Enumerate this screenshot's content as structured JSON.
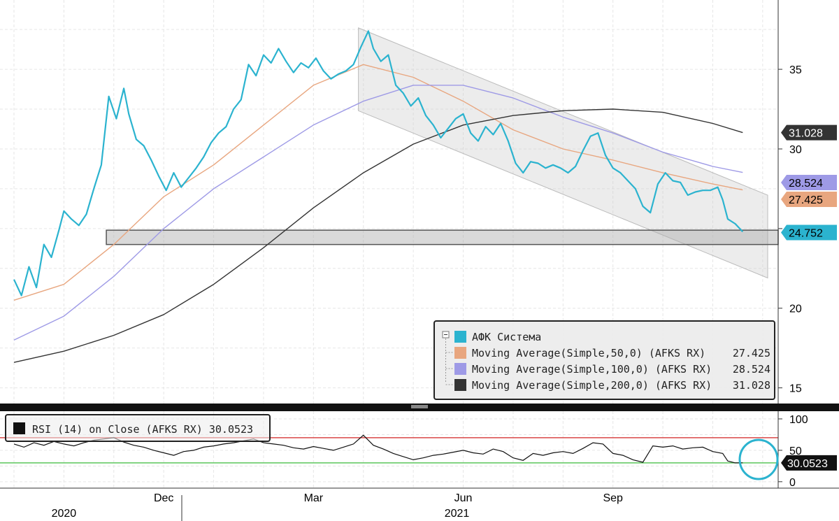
{
  "chart_data": [
    {
      "type": "line",
      "title": "",
      "ylim": [
        14.5,
        39
      ],
      "y_ticks": [
        15,
        20,
        25,
        30,
        35
      ],
      "y_tick_labels": [
        "15",
        "20",
        "",
        "30",
        "35"
      ],
      "x_ticks": [
        {
          "x": 3,
          "label": "Dec"
        },
        {
          "x": 6,
          "label": "Mar"
        },
        {
          "x": 9,
          "label": "Jun"
        },
        {
          "x": 12,
          "label": "Sep"
        }
      ],
      "years": [
        {
          "x": 1,
          "label": "2020"
        },
        {
          "x": 9,
          "label": "2021"
        }
      ],
      "xlim": [
        0,
        15.1
      ],
      "grid": true,
      "legend_position": "bottom-right",
      "series": [
        {
          "name": "АФК Система",
          "color": "#2bb3cf",
          "last_value": "24.752",
          "points": [
            [
              0,
              21.8
            ],
            [
              0.15,
              20.8
            ],
            [
              0.3,
              22.6
            ],
            [
              0.45,
              21.3
            ],
            [
              0.6,
              24.0
            ],
            [
              0.75,
              23.2
            ],
            [
              0.9,
              24.9
            ],
            [
              1.0,
              26.1
            ],
            [
              1.15,
              25.6
            ],
            [
              1.3,
              25.2
            ],
            [
              1.45,
              25.9
            ],
            [
              1.6,
              27.5
            ],
            [
              1.75,
              29.0
            ],
            [
              1.9,
              33.3
            ],
            [
              2.05,
              31.9
            ],
            [
              2.2,
              33.8
            ],
            [
              2.3,
              32.2
            ],
            [
              2.45,
              30.6
            ],
            [
              2.6,
              30.2
            ],
            [
              2.75,
              29.3
            ],
            [
              2.9,
              28.3
            ],
            [
              3.05,
              27.4
            ],
            [
              3.2,
              28.5
            ],
            [
              3.35,
              27.6
            ],
            [
              3.5,
              28.2
            ],
            [
              3.65,
              28.8
            ],
            [
              3.8,
              29.5
            ],
            [
              3.95,
              30.4
            ],
            [
              4.1,
              31.0
            ],
            [
              4.25,
              31.4
            ],
            [
              4.4,
              32.5
            ],
            [
              4.55,
              33.1
            ],
            [
              4.7,
              35.3
            ],
            [
              4.85,
              34.6
            ],
            [
              5.0,
              35.9
            ],
            [
              5.15,
              35.4
            ],
            [
              5.3,
              36.3
            ],
            [
              5.45,
              35.5
            ],
            [
              5.6,
              34.8
            ],
            [
              5.75,
              35.4
            ],
            [
              5.9,
              35.1
            ],
            [
              6.05,
              35.7
            ],
            [
              6.2,
              34.9
            ],
            [
              6.35,
              34.4
            ],
            [
              6.5,
              34.7
            ],
            [
              6.65,
              34.9
            ],
            [
              6.8,
              35.3
            ],
            [
              6.95,
              36.4
            ],
            [
              7.1,
              37.4
            ],
            [
              7.2,
              36.3
            ],
            [
              7.35,
              35.5
            ],
            [
              7.5,
              35.9
            ],
            [
              7.65,
              34.0
            ],
            [
              7.8,
              33.5
            ],
            [
              7.95,
              32.7
            ],
            [
              8.1,
              33.2
            ],
            [
              8.25,
              32.1
            ],
            [
              8.4,
              31.5
            ],
            [
              8.55,
              30.7
            ],
            [
              8.7,
              31.3
            ],
            [
              8.85,
              31.9
            ],
            [
              9.0,
              32.2
            ],
            [
              9.15,
              31.0
            ],
            [
              9.3,
              30.5
            ],
            [
              9.45,
              31.4
            ],
            [
              9.6,
              30.9
            ],
            [
              9.75,
              31.6
            ],
            [
              9.9,
              30.5
            ],
            [
              10.05,
              29.1
            ],
            [
              10.2,
              28.5
            ],
            [
              10.35,
              29.2
            ],
            [
              10.5,
              29.1
            ],
            [
              10.65,
              28.8
            ],
            [
              10.8,
              29.0
            ],
            [
              10.95,
              28.8
            ],
            [
              11.1,
              28.5
            ],
            [
              11.25,
              28.9
            ],
            [
              11.4,
              29.9
            ],
            [
              11.55,
              30.8
            ],
            [
              11.7,
              31.0
            ],
            [
              11.85,
              29.6
            ],
            [
              12.0,
              28.8
            ],
            [
              12.15,
              28.5
            ],
            [
              12.3,
              28.0
            ],
            [
              12.45,
              27.5
            ],
            [
              12.6,
              26.4
            ],
            [
              12.75,
              26.0
            ],
            [
              12.9,
              27.8
            ],
            [
              13.05,
              28.5
            ],
            [
              13.2,
              28.0
            ],
            [
              13.35,
              27.9
            ],
            [
              13.5,
              27.1
            ],
            [
              13.65,
              27.3
            ],
            [
              13.8,
              27.4
            ],
            [
              13.95,
              27.4
            ],
            [
              14.1,
              27.6
            ],
            [
              14.2,
              26.8
            ],
            [
              14.3,
              25.6
            ],
            [
              14.45,
              25.3
            ],
            [
              14.6,
              24.8
            ]
          ]
        },
        {
          "name": "Moving Average(Simple,50,0) (AFKS RX)",
          "color": "#e8a67f",
          "last_value": "27.425",
          "points": [
            [
              0,
              20.5
            ],
            [
              1,
              21.5
            ],
            [
              2,
              24.0
            ],
            [
              3,
              27.0
            ],
            [
              4,
              29.0
            ],
            [
              5,
              31.5
            ],
            [
              6,
              34.0
            ],
            [
              7,
              35.3
            ],
            [
              8,
              34.5
            ],
            [
              9,
              33.0
            ],
            [
              10,
              31.2
            ],
            [
              11,
              30.0
            ],
            [
              12,
              29.3
            ],
            [
              13,
              28.5
            ],
            [
              14,
              27.8
            ],
            [
              14.6,
              27.425
            ]
          ]
        },
        {
          "name": "Moving Average(Simple,100,0) (AFKS RX)",
          "color": "#9e9ae6",
          "last_value": "28.524",
          "points": [
            [
              0,
              18.0
            ],
            [
              1,
              19.5
            ],
            [
              2,
              22.0
            ],
            [
              3,
              25.0
            ],
            [
              4,
              27.5
            ],
            [
              5,
              29.5
            ],
            [
              6,
              31.5
            ],
            [
              7,
              33.0
            ],
            [
              8,
              34.0
            ],
            [
              9,
              34.0
            ],
            [
              10,
              33.2
            ],
            [
              11,
              32.0
            ],
            [
              12,
              31.0
            ],
            [
              13,
              29.8
            ],
            [
              14,
              28.9
            ],
            [
              14.6,
              28.524
            ]
          ]
        },
        {
          "name": "Moving Average(Simple,200,0) (AFKS RX)",
          "color": "#333333",
          "last_value": "31.028",
          "points": [
            [
              0,
              16.6
            ],
            [
              1,
              17.3
            ],
            [
              2,
              18.3
            ],
            [
              3,
              19.6
            ],
            [
              4,
              21.5
            ],
            [
              5,
              23.8
            ],
            [
              6,
              26.3
            ],
            [
              7,
              28.5
            ],
            [
              8,
              30.3
            ],
            [
              9,
              31.5
            ],
            [
              10,
              32.1
            ],
            [
              11,
              32.4
            ],
            [
              12,
              32.5
            ],
            [
              13,
              32.3
            ],
            [
              14,
              31.6
            ],
            [
              14.6,
              31.028
            ]
          ]
        }
      ],
      "channel": {
        "upper": [
          [
            6.9,
            37.6
          ],
          [
            15.1,
            27.1
          ]
        ],
        "lower": [
          [
            6.9,
            32.4
          ],
          [
            15.1,
            21.9
          ]
        ]
      },
      "support_band": [
        24.0,
        24.9
      ]
    },
    {
      "type": "line",
      "ylim": [
        -8,
        110
      ],
      "y_ticks": [
        0,
        50,
        100
      ],
      "y_tick_labels": [
        "0",
        "50",
        "100"
      ],
      "grid": true,
      "levels": [
        {
          "value": 70,
          "color": "#d94848"
        },
        {
          "value": 30,
          "color": "#5cc65c"
        }
      ],
      "series": [
        {
          "name": "RSI (14) on Close (AFKS RX)",
          "color": "#111111",
          "last_value": "30.0523",
          "points": [
            [
              0,
              60
            ],
            [
              0.2,
              55
            ],
            [
              0.4,
              62
            ],
            [
              0.6,
              58
            ],
            [
              0.8,
              64
            ],
            [
              1.0,
              60
            ],
            [
              1.2,
              57
            ],
            [
              1.4,
              62
            ],
            [
              1.6,
              66
            ],
            [
              1.8,
              68
            ],
            [
              2.0,
              70
            ],
            [
              2.2,
              63
            ],
            [
              2.4,
              58
            ],
            [
              2.6,
              55
            ],
            [
              2.8,
              50
            ],
            [
              3.0,
              46
            ],
            [
              3.2,
              42
            ],
            [
              3.4,
              48
            ],
            [
              3.6,
              50
            ],
            [
              3.8,
              55
            ],
            [
              4.0,
              57
            ],
            [
              4.2,
              60
            ],
            [
              4.4,
              62
            ],
            [
              4.6,
              65
            ],
            [
              4.8,
              68
            ],
            [
              5.0,
              62
            ],
            [
              5.2,
              60
            ],
            [
              5.4,
              58
            ],
            [
              5.6,
              54
            ],
            [
              5.8,
              52
            ],
            [
              6.0,
              56
            ],
            [
              6.2,
              53
            ],
            [
              6.4,
              50
            ],
            [
              6.6,
              55
            ],
            [
              6.8,
              60
            ],
            [
              7.0,
              74
            ],
            [
              7.2,
              58
            ],
            [
              7.4,
              52
            ],
            [
              7.6,
              45
            ],
            [
              7.8,
              40
            ],
            [
              8.0,
              35
            ],
            [
              8.2,
              38
            ],
            [
              8.4,
              42
            ],
            [
              8.6,
              44
            ],
            [
              8.8,
              47
            ],
            [
              9.0,
              50
            ],
            [
              9.2,
              46
            ],
            [
              9.4,
              44
            ],
            [
              9.6,
              52
            ],
            [
              9.8,
              48
            ],
            [
              10.0,
              38
            ],
            [
              10.2,
              34
            ],
            [
              10.4,
              45
            ],
            [
              10.6,
              42
            ],
            [
              10.8,
              46
            ],
            [
              11.0,
              48
            ],
            [
              11.2,
              45
            ],
            [
              11.4,
              53
            ],
            [
              11.6,
              62
            ],
            [
              11.8,
              60
            ],
            [
              12.0,
              45
            ],
            [
              12.2,
              42
            ],
            [
              12.4,
              35
            ],
            [
              12.6,
              31
            ],
            [
              12.8,
              57
            ],
            [
              13.0,
              55
            ],
            [
              13.2,
              57
            ],
            [
              13.4,
              52
            ],
            [
              13.6,
              54
            ],
            [
              13.8,
              55
            ],
            [
              14.0,
              48
            ],
            [
              14.2,
              45
            ],
            [
              14.3,
              33
            ],
            [
              14.45,
              30
            ],
            [
              14.6,
              30.05
            ]
          ]
        }
      ]
    }
  ]
}
